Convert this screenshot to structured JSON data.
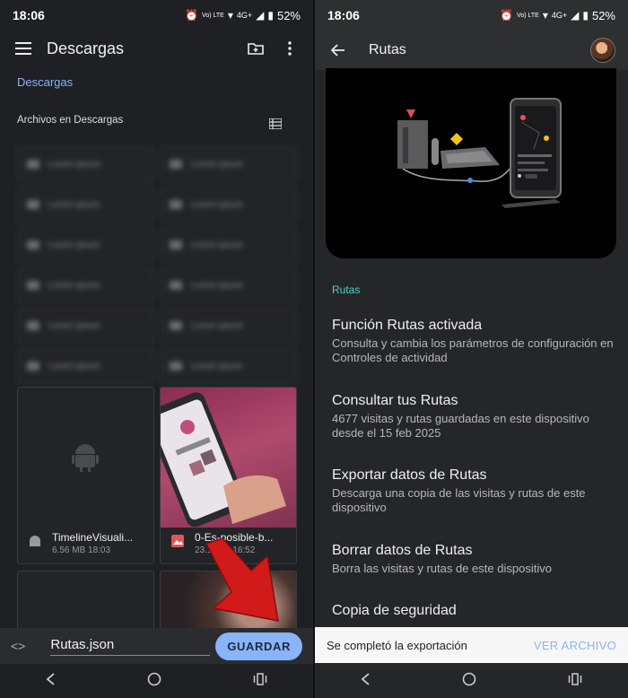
{
  "left": {
    "status": {
      "time": "18:06",
      "net": "4G+",
      "volte": "Vo) LTE",
      "battery": "52%"
    },
    "appbar": {
      "title": "Descargas"
    },
    "breadcrumb": "Descargas",
    "section_header": "Archivos en Descargas",
    "folders": [
      [
        "Lorem ipsum",
        "Lorem ipsum"
      ],
      [
        "Lorem ipsum",
        "Lorem ipsum"
      ],
      [
        "Lorem ipsum",
        "Lorem ipsum"
      ],
      [
        "Lorem ipsum",
        "Lorem ipsum"
      ],
      [
        "Lorem ipsum",
        "Lorem ipsum"
      ],
      [
        "Lorem ipsum",
        "Lorem ipsum"
      ]
    ],
    "files": [
      {
        "name": "TimelineVisuali...",
        "meta": "6.56 MB 18:03",
        "type": "android"
      },
      {
        "name": "0-Es-posible-b...",
        "meta": "23.12 kB 16:52",
        "type": "image"
      }
    ],
    "save": {
      "filename": "Rutas.json",
      "button": "GUARDAR"
    }
  },
  "right": {
    "status": {
      "time": "18:06",
      "net": "4G+",
      "volte": "Vo) LTE",
      "battery": "52%"
    },
    "appbar": {
      "title": "Rutas"
    },
    "section": "Rutas",
    "items": [
      {
        "title": "Función Rutas activada",
        "subtitle": "Consulta y cambia los parámetros de configuración en Controles de actividad"
      },
      {
        "title": "Consultar tus Rutas",
        "subtitle": "4677 visitas y rutas guardadas en este dispositivo desde el 15 feb 2025"
      },
      {
        "title": "Exportar datos de Rutas",
        "subtitle": "Descarga una copia de las visitas y rutas de este dispositivo"
      },
      {
        "title": "Borrar datos de Rutas",
        "subtitle": "Borra las visitas y rutas de este dispositivo"
      },
      {
        "title": "Copia de seguridad",
        "subtitle": ""
      }
    ],
    "snackbar": {
      "message": "Se completó la exportación",
      "action": "VER ARCHIVO"
    }
  },
  "colors": {
    "accent_blue": "#8ab4f8",
    "accent_teal": "#4dd0c8",
    "red_arrow": "#d11a1a"
  }
}
